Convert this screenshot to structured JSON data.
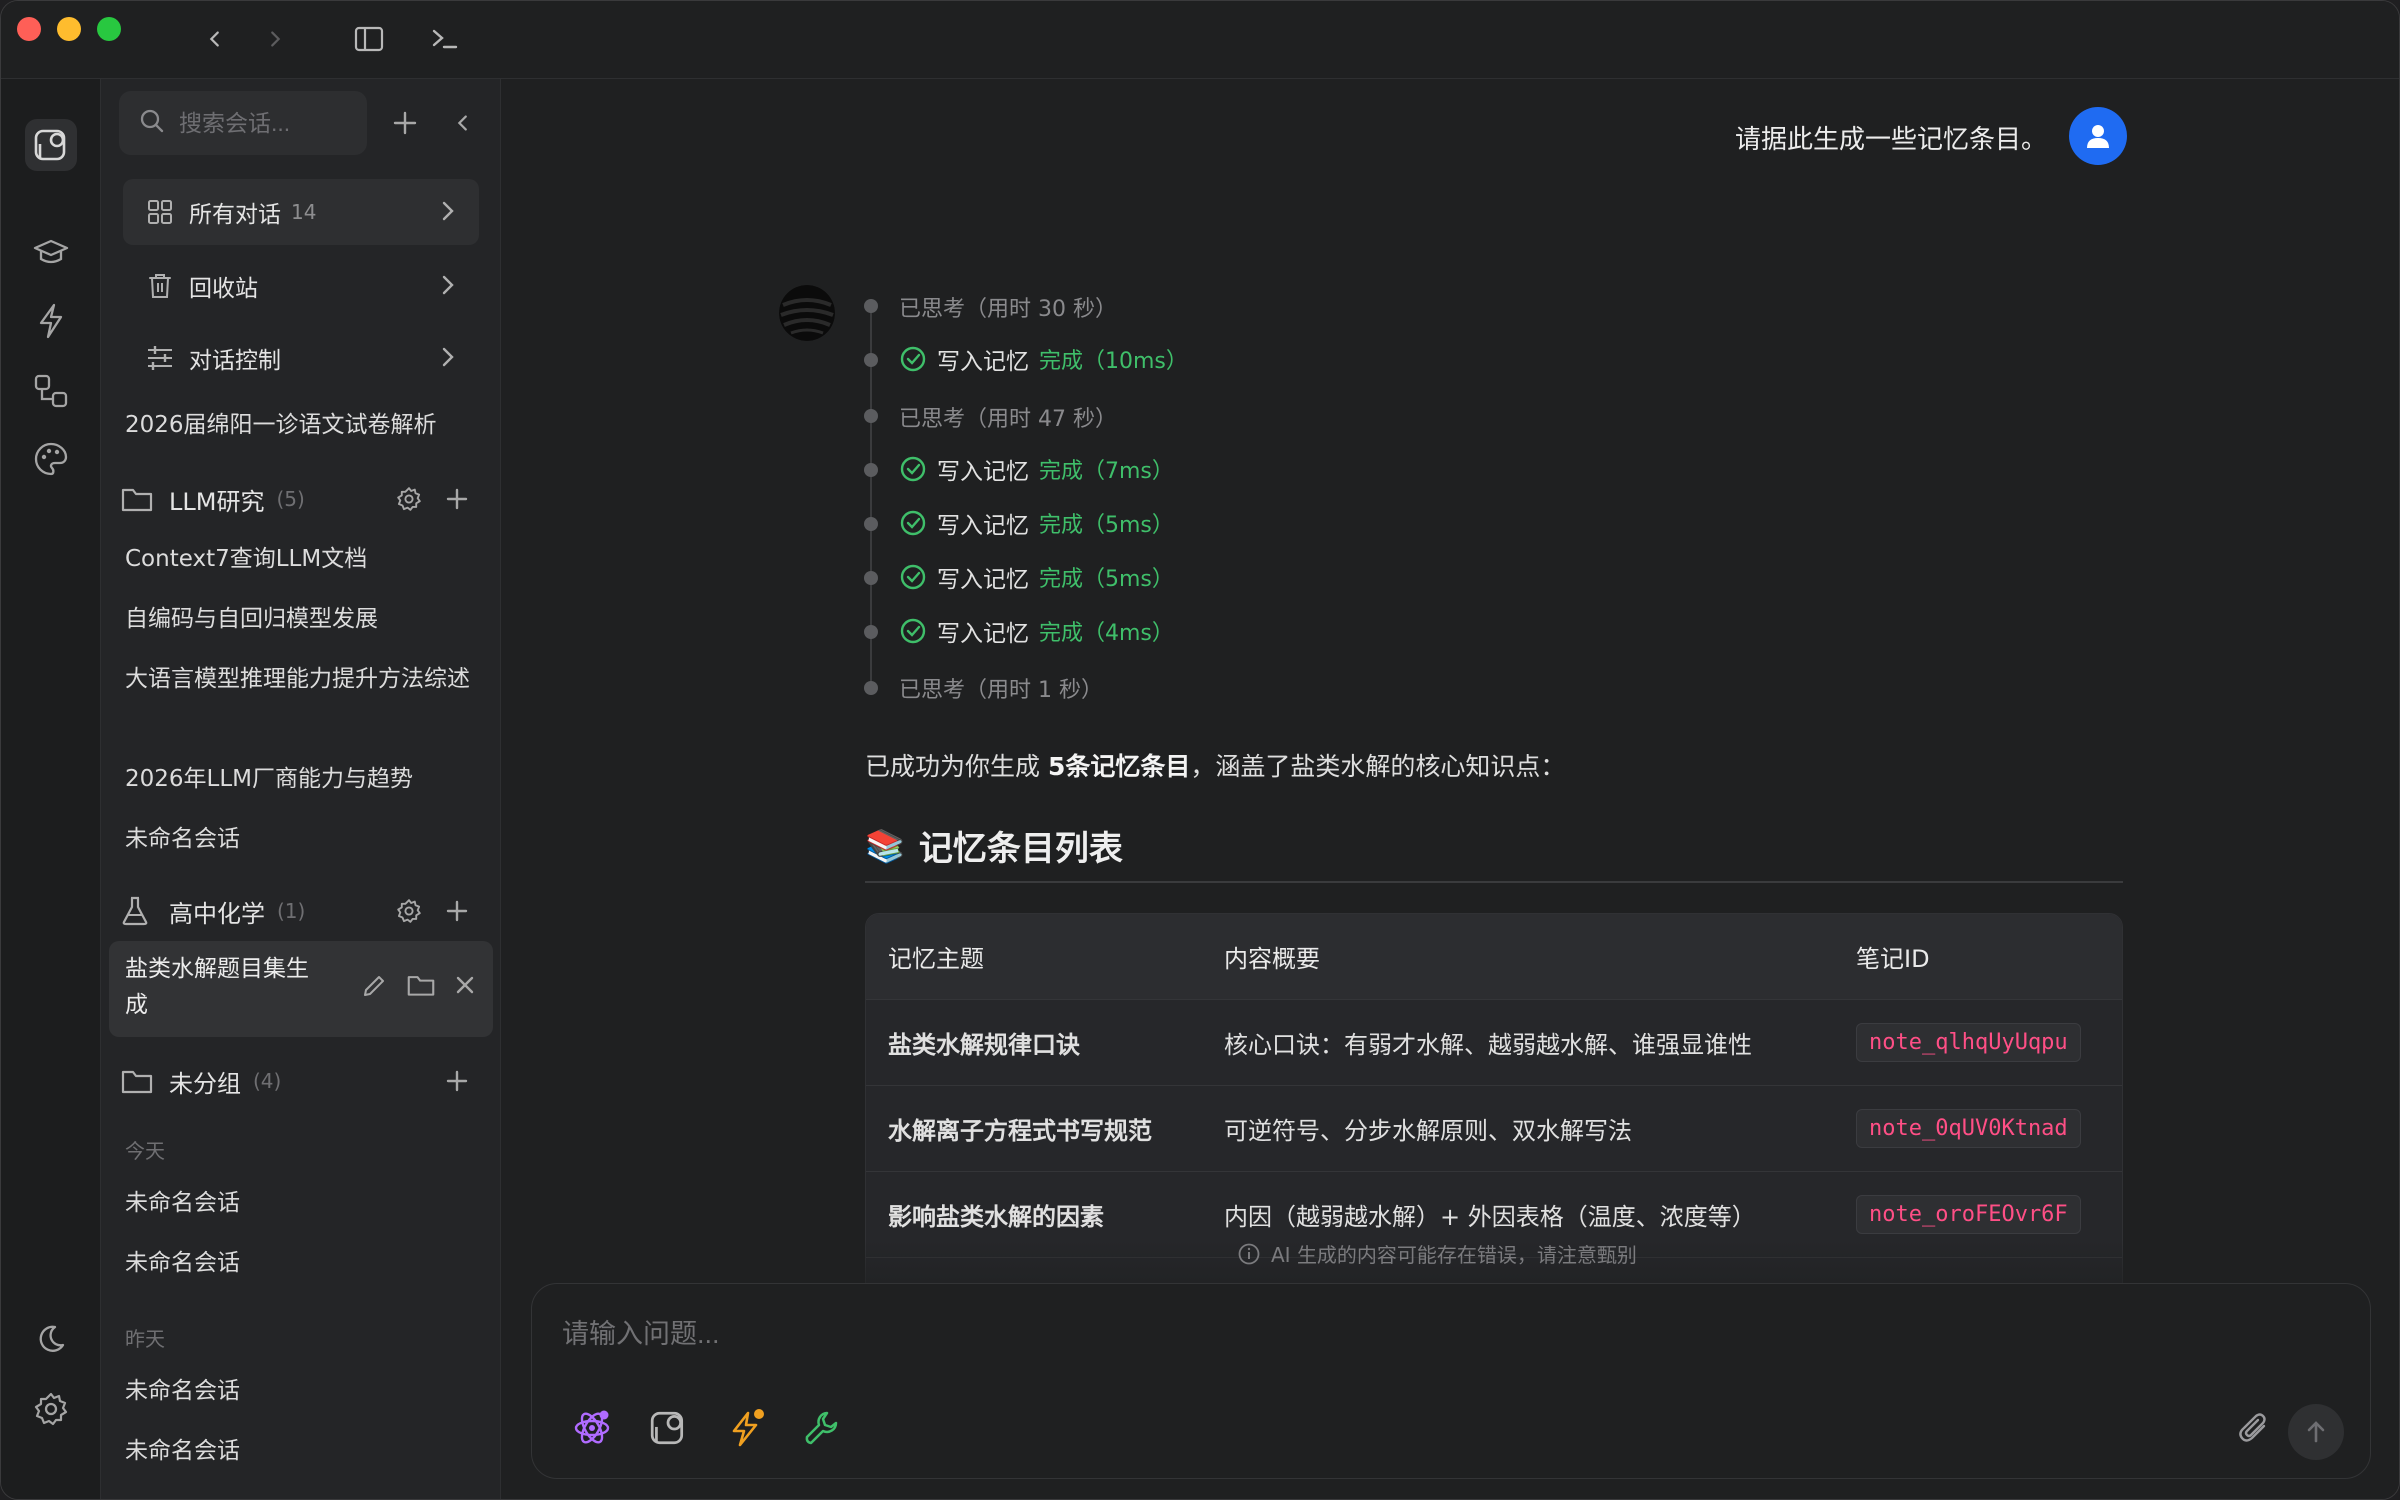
{
  "sidebar": {
    "search_placeholder": "搜索会话...",
    "nav": [
      {
        "label": "所有对话",
        "count": "14"
      },
      {
        "label": "回收站"
      },
      {
        "label": "对话控制"
      }
    ],
    "pinned": "2026届绵阳一诊语文试卷解析",
    "groups": [
      {
        "name": "LLM研究",
        "count": "(5)",
        "items": [
          "Context7查询LLM文档",
          "自编码与自回归模型发展",
          "大语言模型推理能力提升方法综述",
          "2026年LLM厂商能力与趋势",
          "未命名会话"
        ]
      },
      {
        "name": "高中化学",
        "count": "(1)",
        "items": [
          "盐类水解题目集生成"
        ]
      },
      {
        "name": "未分组",
        "count": "(4)"
      }
    ],
    "sections": [
      {
        "label": "今天",
        "items": [
          "未命名会话",
          "未命名会话"
        ]
      },
      {
        "label": "昨天",
        "items": [
          "未命名会话",
          "未命名会话"
        ]
      }
    ]
  },
  "chat": {
    "user_message": "请据此生成一些记忆条目。",
    "steps": [
      {
        "kind": "think",
        "text": "已思考（用时 30 秒）"
      },
      {
        "kind": "tool",
        "title": "写入记忆",
        "status": "完成（10ms）"
      },
      {
        "kind": "think",
        "text": "已思考（用时 47 秒）"
      },
      {
        "kind": "tool",
        "title": "写入记忆",
        "status": "完成（7ms）"
      },
      {
        "kind": "tool",
        "title": "写入记忆",
        "status": "完成（5ms）"
      },
      {
        "kind": "tool",
        "title": "写入记忆",
        "status": "完成（5ms）"
      },
      {
        "kind": "tool",
        "title": "写入记忆",
        "status": "完成（4ms）"
      },
      {
        "kind": "think",
        "text": "已思考（用时 1 秒）"
      }
    ],
    "summary_pre": "已成功为你生成 ",
    "summary_bold": "5条记忆条目",
    "summary_post": "，涵盖了盐类水解的核心知识点：",
    "heading_emoji": "📚",
    "heading": "记忆条目列表",
    "table": {
      "headers": [
        "记忆主题",
        "内容概要",
        "笔记ID"
      ],
      "rows": [
        [
          "盐类水解规律口诀",
          "核心口诀：有弱才水解、越弱越水解、谁强显谁性",
          "note_qlhqUyUqpu"
        ],
        [
          "水解离子方程式书写规范",
          "可逆符号、分步水解原则、双水解写法",
          "note_0qUV0Ktnad"
        ],
        [
          "影响盐类水解的因素",
          "内因（越弱越水解）+ 外因表格（温度、浓度等）",
          "note_oroFEOvr6F"
        ]
      ]
    },
    "disclaimer": "AI 生成的内容可能存在错误，请注意甄别"
  },
  "composer": {
    "placeholder": "请输入问题..."
  },
  "colors": {
    "accent_blue": "#1f6bf2",
    "success_green": "#3fbf6a",
    "code_pink": "#ff4f86"
  }
}
